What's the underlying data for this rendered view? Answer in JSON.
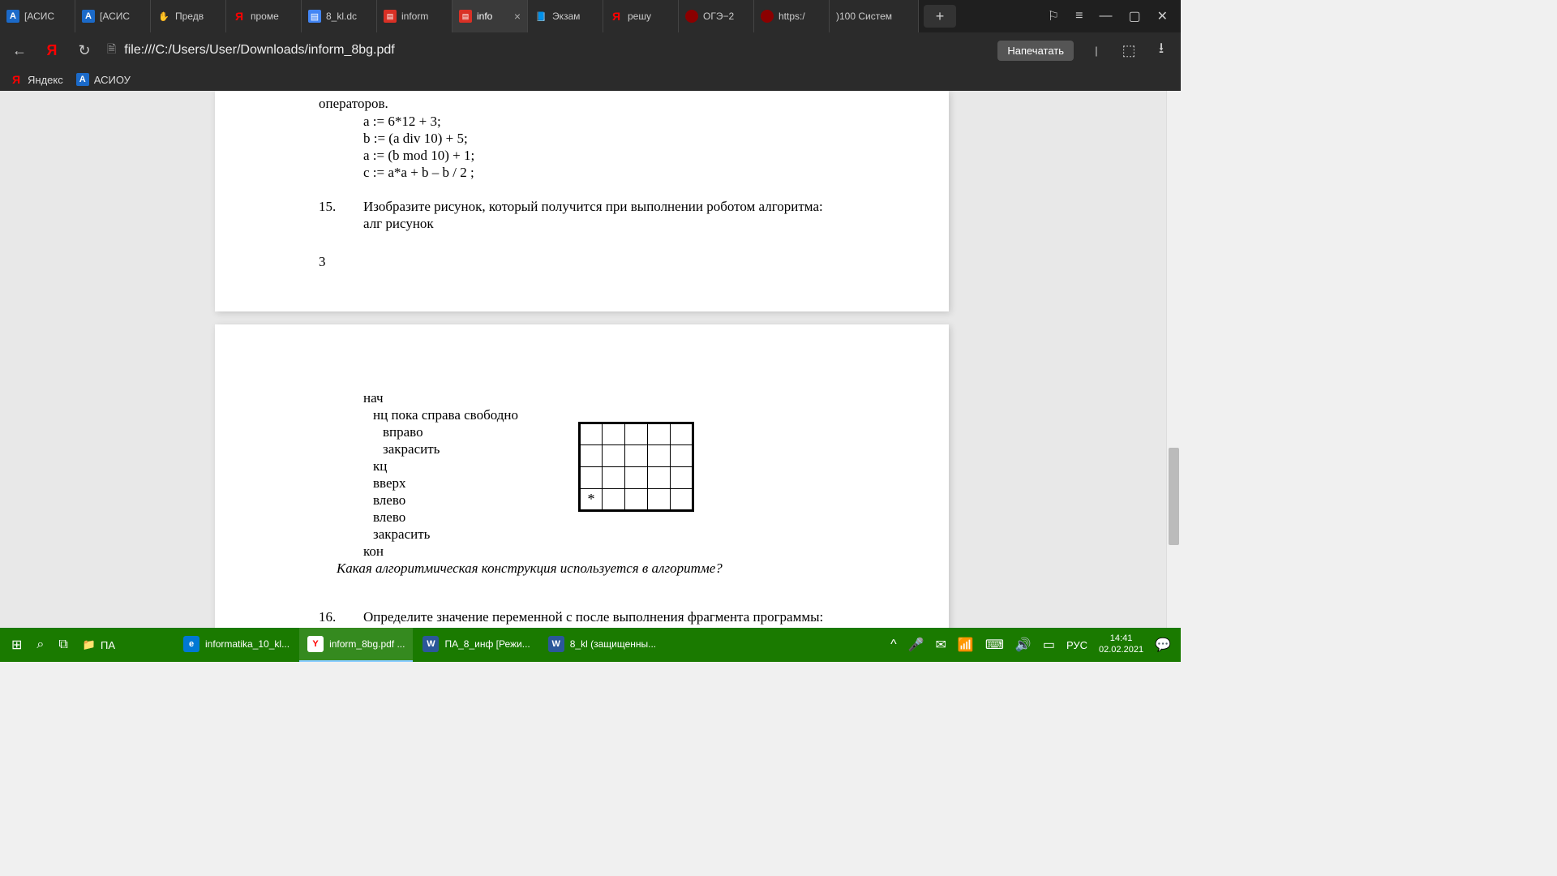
{
  "tabs": [
    {
      "title": "[АСИС",
      "favicon": "A"
    },
    {
      "title": "[АСИС",
      "favicon": "A"
    },
    {
      "title": "Предв",
      "favicon": "✋"
    },
    {
      "title": "проме",
      "favicon": "Я"
    },
    {
      "title": "8_kl.dc",
      "favicon": "▤"
    },
    {
      "title": "inform",
      "favicon": "▤"
    },
    {
      "title": "info",
      "favicon": "▤",
      "active": true
    },
    {
      "title": "Экзам",
      "favicon": "📘"
    },
    {
      "title": "решу",
      "favicon": "Я"
    },
    {
      "title": "ОГЭ−2",
      "favicon": "●"
    },
    {
      "title": "https:/",
      "favicon": "●"
    },
    {
      "title": ")100  Систем",
      "favicon": ""
    }
  ],
  "address": {
    "url": "file:///C:/Users/User/Downloads/inform_8bg.pdf",
    "print": "Напечатать"
  },
  "bookmarks": [
    {
      "icon": "Я",
      "label": "Яндекс"
    },
    {
      "icon": "A",
      "label": "АСИОУ"
    }
  ],
  "doc": {
    "operators": "операторов.",
    "code1": "a := 6*12 + 3;",
    "code2": "b := (a div 10) + 5;",
    "code3": "a := (b mod 10) + 1;",
    "code4": "c := a*a + b – b / 2 ;",
    "q15_num": "15.",
    "q15_text": "Изобразите рисунок, который получится при выполнении роботом алгоритма:",
    "q15_sub": "алг рисунок",
    "pagenum": "3",
    "alg1": "нач",
    "alg2": "нц пока справа свободно",
    "alg3": "вправо",
    "alg4": "закрасить",
    "alg5": "кц",
    "alg6": "вверх",
    "alg7": "влево",
    "alg8": "влево",
    "alg9": "закрасить",
    "alg10": "кон",
    "q15_italic": "Какая алгоритмическая конструкция используется в алгоритме?",
    "q16_num": "16.",
    "q16_text": "Определите значение переменной с после выполнения фрагмента программы:",
    "star": "*"
  },
  "taskbar": {
    "folder": "ПА",
    "apps": [
      {
        "label": "informatika_10_kl...",
        "icon": "e"
      },
      {
        "label": "inform_8bg.pdf ...",
        "icon": "Y",
        "active": true
      },
      {
        "label": "ПА_8_инф [Режи...",
        "icon": "W"
      },
      {
        "label": "8_kl (защищенны...",
        "icon": "W"
      }
    ],
    "lang": "РУС",
    "time": "14:41",
    "date": "02.02.2021"
  }
}
